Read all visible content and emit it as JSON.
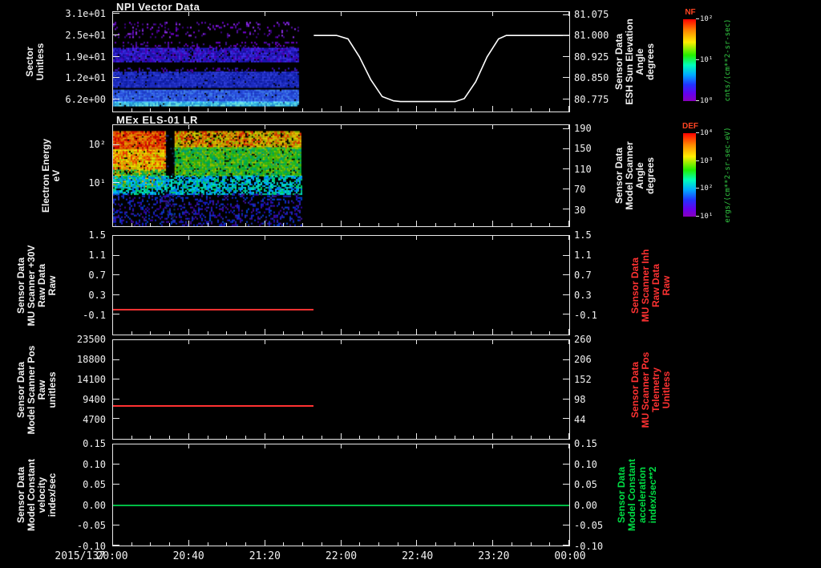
{
  "colors": {
    "bg": "#000000",
    "fg": "#f2f2f2",
    "axis": "#e8e8e8",
    "red": "#ff3232",
    "green": "#00dd44"
  },
  "colorbar_gradient": [
    "#ff0000",
    "#ff8800 14%",
    "#ffee00 28%",
    "#22ee00 44%",
    "#00ffbb 56%",
    "#00aaff 68%",
    "#2233ff 80%",
    "#6600ee 91%",
    "#8800bb 100%"
  ],
  "xaxis": {
    "date": "2015/137",
    "ticks": [
      "20:00",
      "20:40",
      "21:20",
      "22:00",
      "22:40",
      "23:20",
      "00:00"
    ]
  },
  "panels": [
    {
      "title": "NPI Vector Data",
      "left_label_lines": [
        "Sector",
        "Unitless"
      ],
      "right_label_lines": [
        "Sensor Data",
        "ESH Sun Elevation",
        "Angle",
        "degrees"
      ],
      "right_label_color": "#f2f2f2",
      "left_ticks": [
        {
          "label": "3.1e+01",
          "frac": 0.02
        },
        {
          "label": "2.5e+01",
          "frac": 0.235
        },
        {
          "label": "1.9e+01",
          "frac": 0.45
        },
        {
          "label": "1.2e+01",
          "frac": 0.66
        },
        {
          "label": "6.2e+00",
          "frac": 0.875
        }
      ],
      "right_ticks": [
        {
          "label": "81.075",
          "frac": 0.03
        },
        {
          "label": "81.000",
          "frac": 0.24
        },
        {
          "label": "80.925",
          "frac": 0.45
        },
        {
          "label": "80.850",
          "frac": 0.66
        },
        {
          "label": "80.775",
          "frac": 0.875
        }
      ],
      "colorbar": {
        "title": "NF",
        "title_color": "#ff4422",
        "ticks": [
          "10²",
          "10¹",
          "10⁰"
        ],
        "unit": "cnts/(cm**2-sr-sec)",
        "unit_color": "#33cc44"
      },
      "curve": {
        "name": "sun-elevation-curve",
        "color": "#ffffff",
        "points": [
          [
            0.44,
            0.235
          ],
          [
            0.49,
            0.235
          ],
          [
            0.515,
            0.27
          ],
          [
            0.54,
            0.45
          ],
          [
            0.565,
            0.68
          ],
          [
            0.59,
            0.85
          ],
          [
            0.615,
            0.893
          ],
          [
            0.63,
            0.9
          ],
          [
            0.75,
            0.9
          ],
          [
            0.77,
            0.87
          ],
          [
            0.795,
            0.7
          ],
          [
            0.82,
            0.45
          ],
          [
            0.845,
            0.27
          ],
          [
            0.862,
            0.235
          ],
          [
            1.0,
            0.235
          ]
        ]
      },
      "spectro": {
        "x_end_frac": 0.405,
        "cell": 2,
        "bands": [
          {
            "y0": 0.1,
            "y1": 0.26,
            "density": 0.14,
            "colors": [
              "#7a00e0",
              "#5510aa",
              "#9933ff",
              "#40008c"
            ]
          },
          {
            "y0": 0.3,
            "y1": 0.36,
            "density": 0.2,
            "colors": [
              "#6a00cc",
              "#44149e"
            ]
          },
          {
            "y0": 0.36,
            "y1": 0.5,
            "density": 0.93,
            "colors": [
              "#2218cc",
              "#3326e6",
              "#1a10aa",
              "#4433ff",
              "#5500cc"
            ]
          },
          {
            "y0": 0.56,
            "y1": 0.6,
            "density": 0.25,
            "colors": [
              "#5500bb",
              "#3322cc"
            ]
          },
          {
            "y0": 0.6,
            "y1": 0.76,
            "density": 0.95,
            "colors": [
              "#2233dd",
              "#1f2fd0",
              "#3344ee",
              "#1122bb"
            ]
          },
          {
            "y0": 0.78,
            "y1": 0.9,
            "density": 0.97,
            "colors": [
              "#2a55f0",
              "#3a66ff",
              "#2244dd",
              "#4488ff"
            ]
          },
          {
            "y0": 0.9,
            "y1": 0.945,
            "density": 0.97,
            "colors": [
              "#55e0ff",
              "#33c8ff",
              "#77ffff",
              "#2a9fe8"
            ]
          }
        ]
      }
    },
    {
      "title": "MEx ELS-01 LR",
      "left_label_lines": [
        "Electron Energy",
        "eV"
      ],
      "right_label_lines": [
        "Sensor Data",
        "Model Scanner",
        "Angle",
        "degrees"
      ],
      "right_label_color": "#f2f2f2",
      "left_ticks": [
        {
          "label": "10²",
          "frac": 0.195
        },
        {
          "label": "10¹",
          "frac": 0.57
        }
      ],
      "right_ticks": [
        {
          "label": "190",
          "frac": 0.04
        },
        {
          "label": "150",
          "frac": 0.235
        },
        {
          "label": "110",
          "frac": 0.435
        },
        {
          "label": "70",
          "frac": 0.635
        },
        {
          "label": "30",
          "frac": 0.835
        }
      ],
      "colorbar": {
        "title": "DEF",
        "title_color": "#ff4422",
        "ticks": [
          "10⁴",
          "10³",
          "10²",
          "10¹"
        ],
        "unit": "ergs/(cm**2-sr-sec-eV)",
        "unit_color": "#33cc44"
      },
      "spectro": {
        "x_end_frac": 0.412,
        "cell": 2,
        "bands": [
          {
            "x0": 0.0,
            "x1": 0.115,
            "y0": 0.06,
            "y1": 0.24,
            "density": 0.95,
            "colors": [
              "#ff2200",
              "#ff5500",
              "#ffaa00",
              "#dd0000",
              "#ff8800"
            ]
          },
          {
            "x0": 0.0,
            "x1": 0.115,
            "y0": 0.24,
            "y1": 0.44,
            "density": 0.95,
            "colors": [
              "#ff8800",
              "#ffee00",
              "#ccdd00",
              "#ff4400",
              "#ffbb00"
            ]
          },
          {
            "x0": 0.0,
            "x1": 0.115,
            "y0": 0.44,
            "y1": 0.6,
            "density": 0.85,
            "colors": [
              "#88cc00",
              "#22cc44",
              "#ffcc00",
              "#00bb66"
            ]
          },
          {
            "x0": 0.115,
            "x1": 0.135,
            "y0": 0.05,
            "y1": 0.95,
            "density": 0.1,
            "colors": [
              "#222288",
              "#114466"
            ]
          },
          {
            "x0": 0.135,
            "x1": 0.412,
            "y0": 0.06,
            "y1": 0.22,
            "density": 0.85,
            "colors": [
              "#ffcc00",
              "#ff8800",
              "#aadd00",
              "#ff3300",
              "#ffee00"
            ]
          },
          {
            "x0": 0.135,
            "x1": 0.412,
            "y0": 0.22,
            "y1": 0.5,
            "density": 0.93,
            "colors": [
              "#55cc00",
              "#00cc44",
              "#aadd00",
              "#00bb88",
              "#33dd22"
            ]
          },
          {
            "x0": 0.0,
            "x1": 0.412,
            "y0": 0.5,
            "y1": 0.68,
            "density": 0.7,
            "colors": [
              "#00bbaa",
              "#00aaff",
              "#0077ee",
              "#00cc66",
              "#00ddcc"
            ]
          },
          {
            "x0": 0.0,
            "x1": 0.412,
            "y0": 0.68,
            "y1": 1.0,
            "density": 0.28,
            "colors": [
              "#2233cc",
              "#4411aa",
              "#0044dd",
              "#3300aa",
              "#1122dd"
            ]
          }
        ]
      }
    },
    {
      "left_label_lines": [
        "Sensor Data",
        "MU Scanner +30V",
        "Raw Data",
        "Raw"
      ],
      "right_label_lines": [
        "Sensor Data",
        "MU Scanner Inh",
        "Raw Data",
        "Raw"
      ],
      "right_label_color": "#ff3232",
      "left_ticks": [
        {
          "label": "1.5",
          "frac": 0.0
        },
        {
          "label": "1.1",
          "frac": 0.2
        },
        {
          "label": "0.7",
          "frac": 0.4
        },
        {
          "label": "0.3",
          "frac": 0.6
        },
        {
          "label": "-0.1",
          "frac": 0.8
        }
      ],
      "right_ticks": [
        {
          "label": "1.5",
          "frac": 0.0
        },
        {
          "label": "1.1",
          "frac": 0.2
        },
        {
          "label": "0.7",
          "frac": 0.4
        },
        {
          "label": "0.3",
          "frac": 0.6
        },
        {
          "label": "-0.1",
          "frac": 0.8
        }
      ],
      "lines": [
        {
          "name": "mu-scanner-raw-line",
          "color": "#ff3232",
          "x0": 0.0,
          "x1": 0.44,
          "y_frac": 0.75,
          "width": 2
        }
      ]
    },
    {
      "left_label_lines": [
        "Sensor Data",
        "Model Scanner Pos",
        "Raw",
        "unitless"
      ],
      "right_label_lines": [
        "Sensor Data",
        "MU Scanner Pos",
        "Telemetry",
        "Unitless"
      ],
      "right_label_color": "#ff3232",
      "left_ticks": [
        {
          "label": "23500",
          "frac": 0.0
        },
        {
          "label": "18800",
          "frac": 0.2
        },
        {
          "label": "14100",
          "frac": 0.4
        },
        {
          "label": "9400",
          "frac": 0.6
        },
        {
          "label": "4700",
          "frac": 0.8
        }
      ],
      "right_ticks": [
        {
          "label": "260",
          "frac": 0.0
        },
        {
          "label": "206",
          "frac": 0.2
        },
        {
          "label": "152",
          "frac": 0.4
        },
        {
          "label": "98",
          "frac": 0.6
        },
        {
          "label": "44",
          "frac": 0.8
        }
      ],
      "lines": [
        {
          "name": "scanner-pos-line",
          "color": "#ff3232",
          "x0": 0.0,
          "x1": 0.44,
          "y_frac": 0.67,
          "width": 2
        }
      ]
    },
    {
      "left_label_lines": [
        "Sensor Data",
        "Model Constant",
        "velocity",
        "index/sec"
      ],
      "right_label_lines": [
        "Sensor Data",
        "Model Constant",
        "acceleration",
        "index/sec**2"
      ],
      "right_label_color": "#00dd44",
      "left_ticks": [
        {
          "label": "0.15",
          "frac": 0.0
        },
        {
          "label": "0.10",
          "frac": 0.2
        },
        {
          "label": "0.05",
          "frac": 0.4
        },
        {
          "label": "0.00",
          "frac": 0.6
        },
        {
          "label": "-0.05",
          "frac": 0.8
        },
        {
          "label": "-0.10",
          "frac": 1.0
        }
      ],
      "right_ticks": [
        {
          "label": "0.15",
          "frac": 0.0
        },
        {
          "label": "0.10",
          "frac": 0.2
        },
        {
          "label": "0.05",
          "frac": 0.4
        },
        {
          "label": "0.00",
          "frac": 0.6
        },
        {
          "label": "-0.05",
          "frac": 0.8
        },
        {
          "label": "-0.10",
          "frac": 1.0
        }
      ],
      "lines": [
        {
          "name": "model-constant-velocity-line",
          "color": "#00bb44",
          "x0": 0.0,
          "x1": 1.0,
          "y_frac": 0.6,
          "width": 2
        }
      ]
    }
  ],
  "chart_data": [
    {
      "type": "heatmap",
      "title": "NPI Vector Data",
      "ylabel": "Sector (Unitless)",
      "ytick_labels": [
        "3.1e+01",
        "2.5e+01",
        "1.9e+01",
        "1.2e+01",
        "6.2e+00"
      ],
      "x_start": "2015/137 20:00",
      "x_end": "21:30",
      "colorbar": {
        "name": "NF",
        "unit": "cnts/(cm**2-sr-sec)",
        "min": "10^0",
        "max": "10^2"
      },
      "note": "sparse purple/blue count bands per sector; data ends near 21:30"
    },
    {
      "type": "line",
      "series": "ESH Sun Elevation Angle (degrees)",
      "axis": "right",
      "ylim": [
        80.775,
        81.075
      ],
      "points_time_value": [
        [
          "21:45",
          81.0
        ],
        [
          "22:00",
          81.0
        ],
        [
          "22:27",
          80.775
        ],
        [
          "23:02",
          80.775
        ],
        [
          "23:27",
          81.0
        ],
        [
          "00:00",
          81.0
        ]
      ]
    },
    {
      "type": "heatmap",
      "title": "MEx ELS-01 LR",
      "ylabel": "Electron Energy (eV)",
      "yscale": "log",
      "ytick_labels": [
        "10^2",
        "10^1"
      ],
      "x_start": "20:00",
      "x_end": "21:35",
      "colorbar": {
        "name": "DEF",
        "unit": "ergs/(cm**2-sr-sec-eV)",
        "min": "10^1",
        "max": "10^4"
      },
      "note": "intense red/yellow flux 20:00-20:25 near 100 eV, green mid energies, sparse blue below; gap after 21:35"
    },
    {
      "type": "line",
      "series": "MU Scanner +30V Raw Data (Raw)",
      "ylim": [
        -0.5,
        1.5
      ],
      "constant_value": 0.0,
      "x_start": "20:00",
      "x_end": "21:45",
      "color": "#ff3232"
    },
    {
      "type": "line",
      "series": "Model Scanner Pos Raw (unitless)",
      "ylim": [
        0,
        23500
      ],
      "constant_value": 7700,
      "x_start": "20:00",
      "x_end": "21:45",
      "color": "#ff3232"
    },
    {
      "type": "line",
      "series": "Model Constant velocity (index/sec)",
      "ylim": [
        -0.1,
        0.15
      ],
      "constant_value": 0.0,
      "x_start": "20:00",
      "x_end": "00:00",
      "color": "#00dd44"
    }
  ]
}
